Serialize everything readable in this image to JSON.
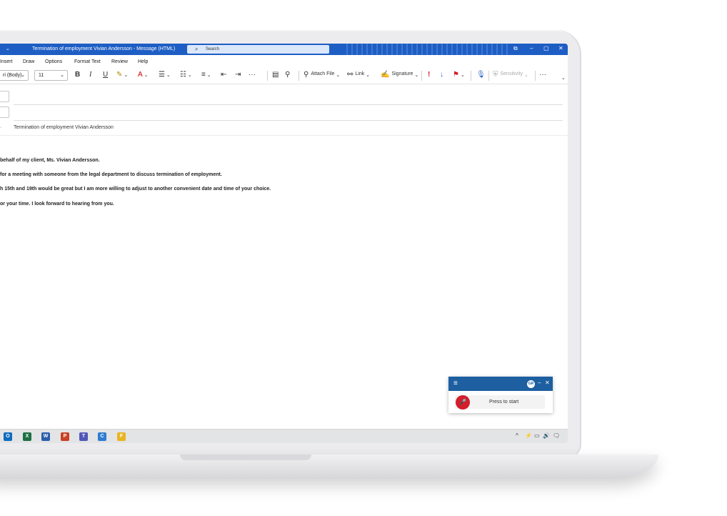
{
  "titlebar": {
    "quick_access": "⌄",
    "title": "Termination of employment Vivian Andersson  -  Message (HTML)",
    "search_placeholder": "Search",
    "restore": "⧉",
    "minimize": "–",
    "maximize": "▢",
    "close": "✕"
  },
  "menu": {
    "insert": "Insert",
    "draw": "Draw",
    "options": "Options",
    "format_text": "Format Text",
    "review": "Review",
    "help": "Help"
  },
  "ribbon": {
    "font_name": "ri (Body)",
    "font_size": "11",
    "bold": "B",
    "italic": "I",
    "underline": "U",
    "attach_file": "Attach File",
    "link": "Link",
    "signature": "Signature",
    "sensitivity": "Sensitivity",
    "more": "···"
  },
  "message": {
    "subject": "Termination of employment Vivian Andersson",
    "body": [
      "behalf of my client, Ms. Vivian Andersson.",
      "for a meeting with someone from the legal department to discuss termination of employment.",
      "h 15th and 19th would be great but I am more willing to adjust to another convenient date and time of your choice.",
      "or your time. I look forward to hearing from you."
    ]
  },
  "dictation": {
    "menu_icon": "≡",
    "avatar": "GR",
    "minimize": "–",
    "close": "✕",
    "mic_icon": "🎤",
    "prompt": "Press to start"
  },
  "taskbar": {
    "apps": [
      {
        "name": "outlook",
        "letter": "O",
        "color": "#0f6cbd"
      },
      {
        "name": "excel",
        "letter": "X",
        "color": "#1d7044"
      },
      {
        "name": "word",
        "letter": "W",
        "color": "#2b5faa"
      },
      {
        "name": "powerpoint",
        "letter": "P",
        "color": "#c84225"
      },
      {
        "name": "teams",
        "letter": "T",
        "color": "#5258b8"
      },
      {
        "name": "contacts",
        "letter": "C",
        "color": "#2f7bd0"
      },
      {
        "name": "file-explorer",
        "letter": "F",
        "color": "#e8b422"
      }
    ],
    "tray": [
      "^",
      "⚡",
      "▭",
      "🔊",
      "🗨"
    ]
  },
  "colors": {
    "accent": "#1e5ec4",
    "dictation_header": "#1d5fa0",
    "mic_button": "#d21f2b",
    "importance_high": "#d21f2b",
    "importance_low": "#1e5ec4"
  }
}
